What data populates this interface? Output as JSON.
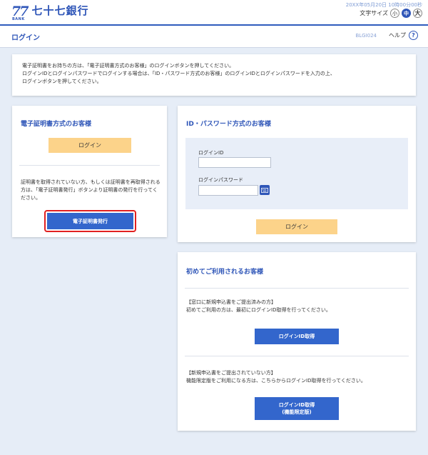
{
  "header": {
    "logo_mark": "77",
    "logo_sub": "BANK",
    "bank_name": "七十七銀行",
    "datetime": "20XX年05月20日 10時00分00秒",
    "font_size_label": "文字サイズ",
    "font_sizes": [
      "小",
      "中",
      "大"
    ]
  },
  "titlebar": {
    "title": "ログイン",
    "screen_id": "BLGI024",
    "help_label": "ヘルプ",
    "help_icon_char": "?"
  },
  "notice": {
    "line1": "電子証明書をお持ちの方は、「電子証明書方式のお客様」のログインボタンを押してください。",
    "line2": "ログインIDとログインパスワードでログインする場合は、「ID・パスワード方式のお客様」のログインIDとログインパスワードを入力の上、",
    "line3": "ログインボタンを押してください。"
  },
  "cert_panel": {
    "title": "電子証明書方式のお客様",
    "login_button": "ログイン",
    "description": "証明書を取得されていない方、もしくは証明書を再取得される方は、「電子証明書発行」ボタンより証明書の発行を行ってください。",
    "issue_button": "電子証明書発行"
  },
  "id_panel": {
    "title": "ID・パスワード方式のお客様",
    "login_id_label": "ログインID",
    "login_id_value": "",
    "password_label": "ログインパスワード",
    "password_value": "",
    "login_button": "ログイン"
  },
  "first_panel": {
    "title": "初めてご利用されるお客様",
    "section1_heading": "【窓口に新規申込書をご提出済みの方】",
    "section1_text": "初めてご利用の方は、最初にログインID取得を行ってください。",
    "section1_button": "ログインID取得",
    "section2_heading": "【新規申込書をご提出されていない方】",
    "section2_text": "機能限定版をご利用になる方は、こちらからログインID取得を行ってください。",
    "section2_button_line1": "ログインID取得",
    "section2_button_line2": "(機能限定版)"
  },
  "colors": {
    "brand_blue": "#2f56b8",
    "button_blue": "#3366cc",
    "button_yellow": "#fcd38a",
    "highlight_red": "#e02020",
    "background": "#e6edf7"
  }
}
